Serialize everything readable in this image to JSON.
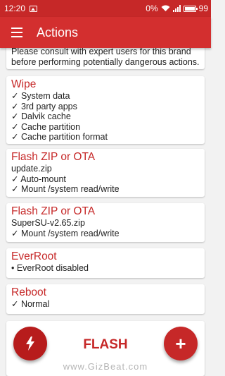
{
  "status_bar": {
    "time": "12:20",
    "battery_percent": "0%",
    "battery_level": "99"
  },
  "app_bar": {
    "title": "Actions",
    "menu_icon": "hamburger-menu-icon"
  },
  "warning_card": {
    "lines": [
      "Please consult with expert users for this brand",
      "before performing potentially dangerous actions."
    ]
  },
  "cards": [
    {
      "title": "Wipe",
      "lines": [
        "✓ System data",
        "✓ 3rd party apps",
        "✓ Dalvik cache",
        "✓ Cache partition",
        "✓ Cache partition format"
      ]
    },
    {
      "title": "Flash ZIP or OTA",
      "lines": [
        "update.zip",
        "✓ Auto-mount",
        "✓ Mount /system read/write"
      ]
    },
    {
      "title": "Flash ZIP or OTA",
      "lines": [
        "SuperSU-v2.65.zip",
        "✓ Mount /system read/write"
      ]
    },
    {
      "title": "EverRoot",
      "lines": [
        "• EverRoot disabled"
      ]
    },
    {
      "title": "Reboot",
      "lines": [
        "✓ Normal"
      ]
    }
  ],
  "bottom": {
    "flash_label": "FLASH",
    "flash_icon": "lightning-bolt-icon",
    "add_icon": "plus-icon",
    "add_symbol": "+"
  },
  "watermark": "www.GizBeat.com",
  "colors": {
    "accent": "#d32f2f",
    "status_bar": "#c62828",
    "title_text": "#c62828"
  }
}
